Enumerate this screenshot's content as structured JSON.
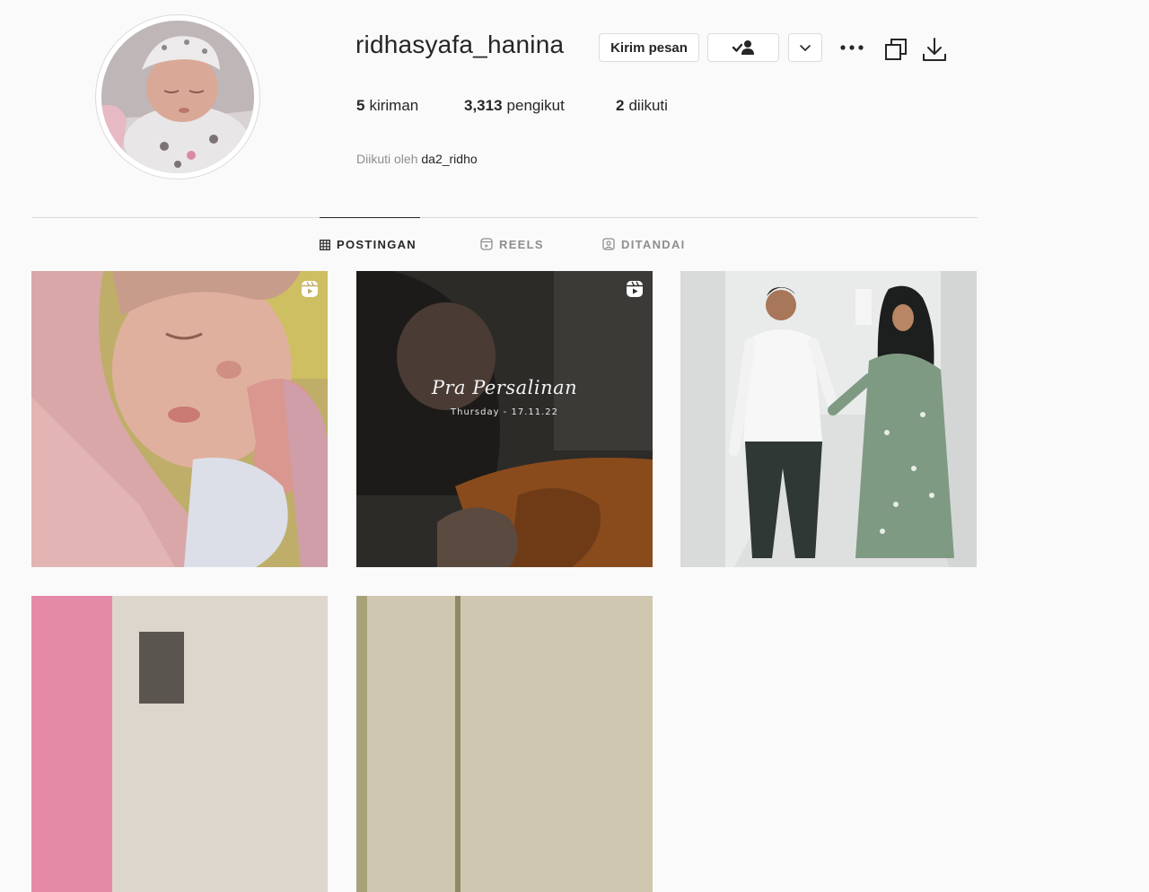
{
  "profile": {
    "username": "ridhasyafa_hanina",
    "message_label": "Kirim pesan",
    "followed_by_prefix": "Diikuti oleh",
    "followed_by_name": "da2_ridho"
  },
  "stats": {
    "posts_count": "5",
    "posts_label": "kiriman",
    "followers_count": "3,313",
    "followers_label": "pengikut",
    "following_count": "2",
    "following_label": "diikuti"
  },
  "icons": {
    "follow_status": "person-check-icon",
    "suggest": "chevron-down-icon",
    "more": "more-horizontal-icon",
    "copy": "copy-icon",
    "download": "download-icon",
    "posts_tab": "grid-icon",
    "reels_tab": "reels-icon",
    "tagged_tab": "tagged-icon",
    "reel_badge": "reel-icon"
  },
  "tabs": {
    "posts": "POSTINGAN",
    "reels": "REELS",
    "tagged": "DITANDAI",
    "active": "posts"
  },
  "posts": [
    {
      "type": "reel"
    },
    {
      "type": "reel",
      "title": "Pra Persalinan",
      "date": "Thursday - 17.11.22"
    },
    {
      "type": "photo"
    },
    {
      "type": "photo"
    },
    {
      "type": "photo"
    }
  ],
  "colors": {
    "background": "#fafafa",
    "text": "#262626",
    "muted": "#8e8e8e",
    "border": "#dbdbdb"
  }
}
